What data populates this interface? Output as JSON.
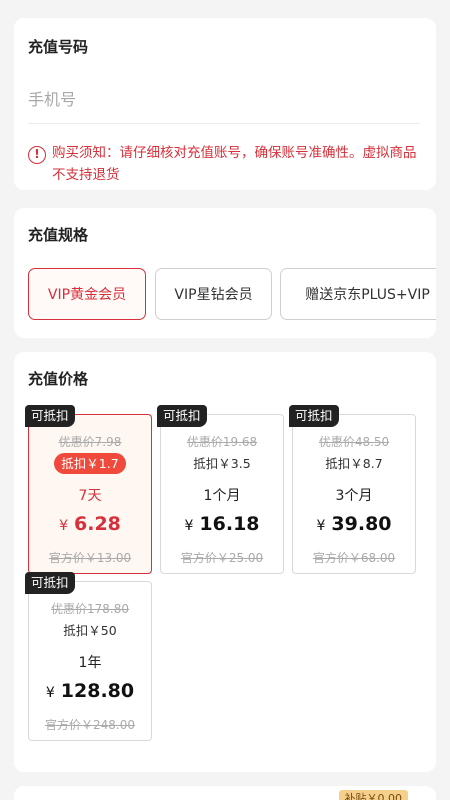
{
  "phone_section": {
    "title": "充值号码",
    "placeholder": "手机号",
    "notice_icon": "!",
    "notice": "购买须知：请仔细核对充值账号，确保账号准确性。虚拟商品不支持退货"
  },
  "spec_section": {
    "title": "充值规格",
    "options": [
      {
        "label": "VIP黄金会员",
        "selected": true
      },
      {
        "label": "VIP星钻会员",
        "selected": false
      },
      {
        "label": "赠送京东PLUS+VIP",
        "selected": false
      }
    ]
  },
  "price_section": {
    "title": "充值价格",
    "currency": "¥",
    "plans": [
      {
        "badge": "可抵扣",
        "original": "优惠价7.98",
        "discount": "抵扣￥1.7",
        "period": "7天",
        "price": "6.28",
        "official": "官方价￥13.00",
        "selected": true
      },
      {
        "badge": "可抵扣",
        "original": "优惠价19.68",
        "discount": "抵扣￥3.5",
        "period": "1个月",
        "price": "16.18",
        "official": "官方价￥25.00",
        "selected": false
      },
      {
        "badge": "可抵扣",
        "original": "优惠价48.50",
        "discount": "抵扣￥8.7",
        "period": "3个月",
        "price": "39.80",
        "official": "官方价￥68.00",
        "selected": false
      },
      {
        "badge": "可抵扣",
        "original": "优惠价178.80",
        "discount": "抵扣￥50",
        "period": "1年",
        "price": "128.80",
        "official": "官方价￥248.00",
        "selected": false
      }
    ]
  },
  "bottom_peek": {
    "tag": "补贴￥0.00"
  },
  "colors": {
    "accent": "#d6303a",
    "discount_pill": "#ef4a3b",
    "badge_bg": "#222222"
  }
}
